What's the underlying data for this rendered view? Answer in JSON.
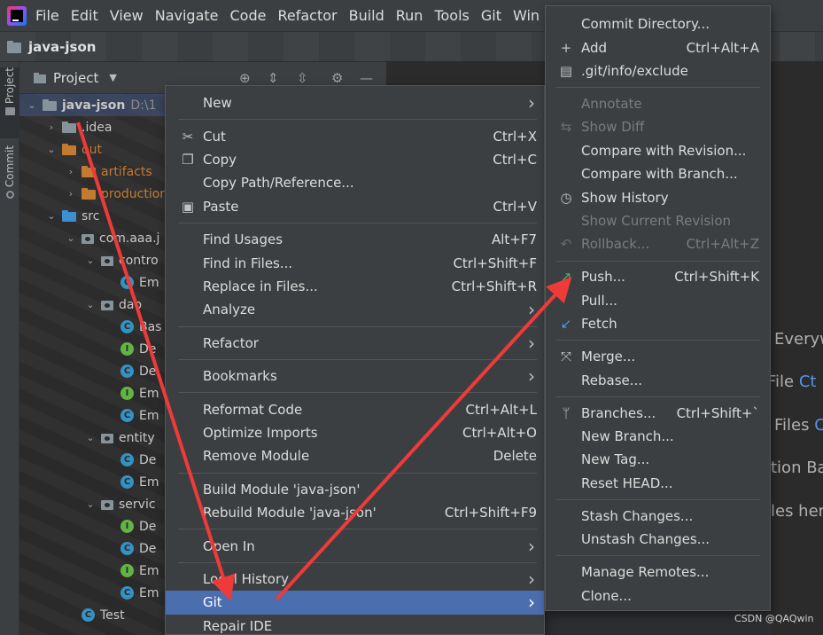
{
  "menubar": {
    "items": [
      "File",
      "Edit",
      "View",
      "Navigate",
      "Code",
      "Refactor",
      "Build",
      "Run",
      "Tools",
      "Git",
      "Win"
    ]
  },
  "titlebar": {
    "project_name": "java-json"
  },
  "tool_strip": {
    "project_tab": "Project",
    "commit_tab": "Commit"
  },
  "project_panel": {
    "title": "Project",
    "tree": [
      {
        "depth": 0,
        "label": "java-json",
        "hint": "D:\\1",
        "icon": "module-folder",
        "expanded": true,
        "bold": true
      },
      {
        "depth": 1,
        "label": ".idea",
        "icon": "folder",
        "expanded": false
      },
      {
        "depth": 1,
        "label": "out",
        "icon": "folder-orange",
        "expanded": true,
        "color": "#c57a32"
      },
      {
        "depth": 2,
        "label": "artifacts",
        "icon": "folder-orange",
        "expanded": false,
        "color": "#c57a32"
      },
      {
        "depth": 2,
        "label": "production",
        "icon": "folder-orange",
        "expanded": false,
        "color": "#c57a32"
      },
      {
        "depth": 1,
        "label": "src",
        "icon": "folder-blue",
        "expanded": true
      },
      {
        "depth": 2,
        "label": "com.aaa.j",
        "icon": "package",
        "expanded": true
      },
      {
        "depth": 3,
        "label": "contro",
        "icon": "package",
        "expanded": true
      },
      {
        "depth": 4,
        "label": "Em",
        "icon": "class-c"
      },
      {
        "depth": 3,
        "label": "dao",
        "icon": "package",
        "expanded": true
      },
      {
        "depth": 4,
        "label": "Bas",
        "icon": "class-c"
      },
      {
        "depth": 4,
        "label": "De",
        "icon": "class-i"
      },
      {
        "depth": 4,
        "label": "De",
        "icon": "class-c"
      },
      {
        "depth": 4,
        "label": "Em",
        "icon": "class-i"
      },
      {
        "depth": 4,
        "label": "Em",
        "icon": "class-c"
      },
      {
        "depth": 3,
        "label": "entity",
        "icon": "package",
        "expanded": true
      },
      {
        "depth": 4,
        "label": "De",
        "icon": "class-c"
      },
      {
        "depth": 4,
        "label": "Em",
        "icon": "class-c"
      },
      {
        "depth": 3,
        "label": "servic",
        "icon": "package",
        "expanded": true
      },
      {
        "depth": 4,
        "label": "De",
        "icon": "class-i"
      },
      {
        "depth": 4,
        "label": "De",
        "icon": "class-c"
      },
      {
        "depth": 4,
        "label": "Em",
        "icon": "class-i"
      },
      {
        "depth": 4,
        "label": "Em",
        "icon": "class-c"
      },
      {
        "depth": 2,
        "label": "Test",
        "icon": "class-c-test"
      }
    ]
  },
  "context_menu": {
    "items": [
      {
        "label": "New",
        "submenu": true
      },
      {
        "sep": true
      },
      {
        "label": "Cut",
        "icon": "scissors-icon",
        "shortcut": "Ctrl+X"
      },
      {
        "label": "Copy",
        "icon": "copy-icon",
        "shortcut": "Ctrl+C"
      },
      {
        "label": "Copy Path/Reference..."
      },
      {
        "label": "Paste",
        "icon": "clipboard-icon",
        "shortcut": "Ctrl+V"
      },
      {
        "sep": true
      },
      {
        "label": "Find Usages",
        "shortcut": "Alt+F7"
      },
      {
        "label": "Find in Files...",
        "shortcut": "Ctrl+Shift+F"
      },
      {
        "label": "Replace in Files...",
        "shortcut": "Ctrl+Shift+R"
      },
      {
        "label": "Analyze",
        "submenu": true
      },
      {
        "sep": true
      },
      {
        "label": "Refactor",
        "submenu": true
      },
      {
        "sep": true
      },
      {
        "label": "Bookmarks",
        "submenu": true
      },
      {
        "sep": true
      },
      {
        "label": "Reformat Code",
        "shortcut": "Ctrl+Alt+L"
      },
      {
        "label": "Optimize Imports",
        "shortcut": "Ctrl+Alt+O"
      },
      {
        "label": "Remove Module",
        "shortcut": "Delete"
      },
      {
        "sep": true
      },
      {
        "label": "Build Module 'java-json'"
      },
      {
        "label": "Rebuild Module 'java-json'",
        "shortcut": "Ctrl+Shift+F9"
      },
      {
        "sep": true
      },
      {
        "label": "Open In",
        "submenu": true
      },
      {
        "sep": true
      },
      {
        "label": "Local History",
        "submenu": true
      },
      {
        "label": "Git",
        "submenu": true,
        "highlighted": true
      },
      {
        "label": "Repair IDE"
      }
    ]
  },
  "git_menu": {
    "items": [
      {
        "label": "Commit Directory..."
      },
      {
        "label": "Add",
        "icon": "plus-icon",
        "shortcut": "Ctrl+Alt+A"
      },
      {
        "label": ".git/info/exclude",
        "icon": "git-file-icon"
      },
      {
        "sep": true
      },
      {
        "label": "Annotate",
        "disabled": true
      },
      {
        "label": "Show Diff",
        "icon": "diff-icon",
        "disabled": true
      },
      {
        "label": "Compare with Revision..."
      },
      {
        "label": "Compare with Branch..."
      },
      {
        "label": "Show History",
        "icon": "clock-icon"
      },
      {
        "label": "Show Current Revision",
        "disabled": true
      },
      {
        "label": "Rollback...",
        "icon": "undo-icon",
        "shortcut": "Ctrl+Alt+Z",
        "disabled": true
      },
      {
        "sep": true
      },
      {
        "label": "Push...",
        "icon": "push-arrow-icon",
        "shortcut": "Ctrl+Shift+K"
      },
      {
        "label": "Pull..."
      },
      {
        "label": "Fetch",
        "icon": "fetch-arrow-icon"
      },
      {
        "sep": true
      },
      {
        "label": "Merge...",
        "icon": "merge-icon"
      },
      {
        "label": "Rebase..."
      },
      {
        "sep": true
      },
      {
        "label": "Branches...",
        "icon": "branch-icon",
        "shortcut": "Ctrl+Shift+`"
      },
      {
        "label": "New Branch..."
      },
      {
        "label": "New Tag..."
      },
      {
        "label": "Reset HEAD..."
      },
      {
        "sep": true
      },
      {
        "label": "Stash Changes..."
      },
      {
        "label": "Unstash Changes..."
      },
      {
        "sep": true
      },
      {
        "label": "Manage Remotes..."
      },
      {
        "label": "Clone..."
      }
    ]
  },
  "editor_hints": [
    "Everyw",
    "File",
    "Ct",
    "Files",
    "C",
    "tion Ba",
    "les her"
  ],
  "watermark": "CSDN @QAQwin",
  "colors": {
    "highlight": "#4b6eaf",
    "annotation_arrow": "#f03a3a",
    "push_icon": "#59a869",
    "fetch_icon": "#5394ec"
  }
}
